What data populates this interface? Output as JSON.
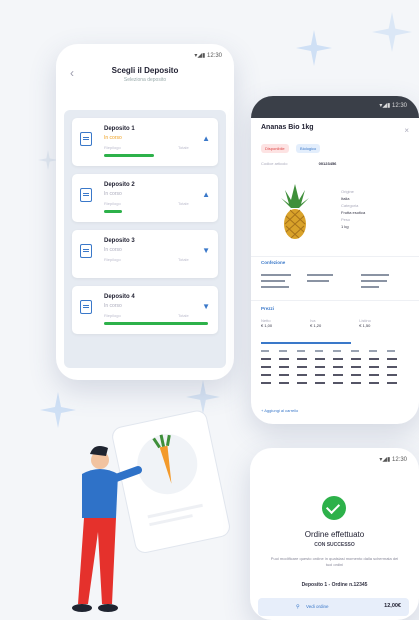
{
  "colors": {
    "accent": "#3a78c9",
    "success": "#2db14a",
    "warning": "#f0a020",
    "background": "#f4f6f9"
  },
  "left_phone": {
    "status": "▾◢▮ 12:30",
    "title": "Scegli il Deposito",
    "subtitle": "Seleziona deposito",
    "deposits": [
      {
        "name": "Deposito 1",
        "detail": "In corso",
        "meta": "Riepilogo",
        "meta2": "Totale",
        "progress": 0.55,
        "chevron": "up",
        "highlight": true
      },
      {
        "name": "Deposito 2",
        "detail": "In corso",
        "meta": "Riepilogo",
        "meta2": "Totale",
        "progress": 0.2,
        "chevron": "up",
        "highlight": false
      },
      {
        "name": "Deposito 3",
        "detail": "In corso",
        "meta": "Riepilogo",
        "meta2": "Totale",
        "progress": 0.0,
        "chevron": "down",
        "highlight": false
      },
      {
        "name": "Deposito 4",
        "detail": "In corso",
        "meta": "Riepilogo",
        "meta2": "Totale",
        "progress": 1.0,
        "chevron": "down",
        "highlight": false
      }
    ]
  },
  "right_phone": {
    "status": "▾◢▮ 12:30",
    "title": "Ananas Bio 1kg",
    "chip1": "Disponibile",
    "chip2": "Biologico",
    "code_label": "Codice articolo",
    "code": "00123456",
    "attr1_label": "Origine",
    "attr1": "Italia",
    "attr2_label": "Categoria",
    "attr2": "Frutta esotica",
    "attr3_label": "Peso",
    "attr3": "1 kg",
    "sec1": "Confezione",
    "sec2": "Prezzi",
    "footer_link": "Aggiungi al carrello",
    "price_labels": [
      "Netto",
      "Iva",
      "Listino"
    ],
    "price_values": [
      "€ 1,00",
      "€ 1,20",
      "€ 1,50"
    ]
  },
  "bottom_phone": {
    "status": "▾◢▮ 12:30",
    "title": "Ordine effettuato",
    "subtitle": "CON SUCCESSO",
    "message": "Puoi modificare questo ordine in qualsiasi momento dalla schermata dei tuoi ordini",
    "deposit_row": "Deposito 1 - Ordine n.12345",
    "button_label": "Vedi ordine",
    "total": "12,00€"
  }
}
